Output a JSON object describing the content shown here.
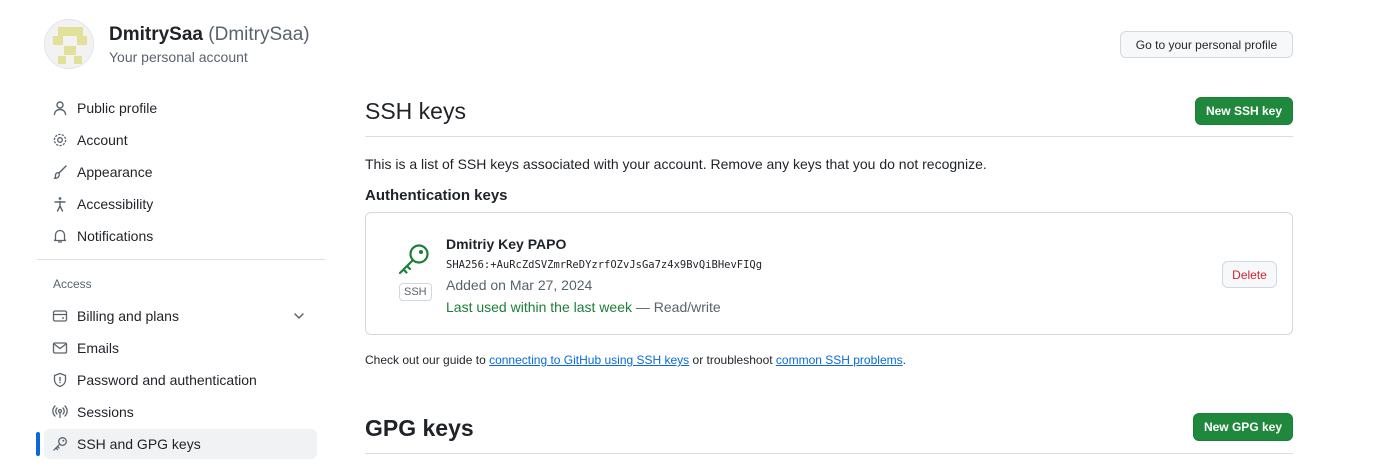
{
  "user": {
    "display_name": "DmitrySaa",
    "login": "(DmitrySaa)",
    "subtitle": "Your personal account",
    "profile_button": "Go to your personal profile"
  },
  "sidebar": {
    "items": [
      {
        "label": "Public profile",
        "icon": "person-icon"
      },
      {
        "label": "Account",
        "icon": "gear-icon"
      },
      {
        "label": "Appearance",
        "icon": "paintbrush-icon"
      },
      {
        "label": "Accessibility",
        "icon": "accessibility-icon"
      },
      {
        "label": "Notifications",
        "icon": "bell-icon"
      }
    ],
    "access_heading": "Access",
    "access_items": [
      {
        "label": "Billing and plans",
        "icon": "credit-card-icon"
      },
      {
        "label": "Emails",
        "icon": "mail-icon"
      },
      {
        "label": "Password and authentication",
        "icon": "shield-icon"
      },
      {
        "label": "Sessions",
        "icon": "broadcast-icon"
      },
      {
        "label": "SSH and GPG keys",
        "icon": "key-icon"
      }
    ]
  },
  "ssh": {
    "title": "SSH keys",
    "new_button": "New SSH key",
    "description": "This is a list of SSH keys associated with your account. Remove any keys that you do not recognize.",
    "auth_heading": "Authentication keys",
    "key": {
      "name": "Dmitriy Key PAPO",
      "fingerprint": "SHA256:+AuRcZdSVZmrReDYzrfOZvJsGa7z4x9BvQiBHevFIQg",
      "added": "Added on Mar 27, 2024",
      "last_used": "Last used within the last week",
      "access": " — Read/write",
      "type_label": "SSH",
      "delete_button": "Delete"
    },
    "guide": {
      "prefix": "Check out our guide to ",
      "link1": "connecting to GitHub using SSH keys",
      "middle": " or troubleshoot ",
      "link2": "common SSH problems",
      "suffix": "."
    }
  },
  "gpg": {
    "title": "GPG keys",
    "new_button": "New GPG key"
  },
  "colors": {
    "accent": "#0969da",
    "green": "#1f883d",
    "danger": "#d1242f"
  }
}
